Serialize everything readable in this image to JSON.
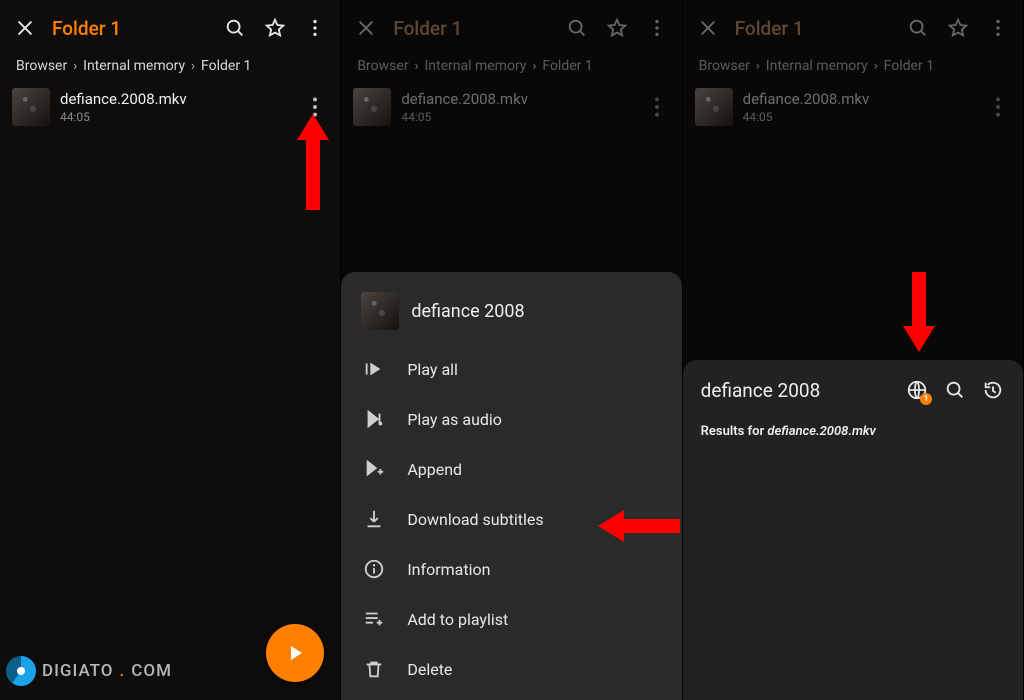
{
  "colors": {
    "accent": "#ff7f00",
    "arrow": "#ff0000"
  },
  "watermark": {
    "text_main": "DIGIATO",
    "text_dot": ".",
    "text_tld": "COM"
  },
  "header": {
    "title": "Folder 1",
    "icons": {
      "close": "close-icon",
      "search": "search-icon",
      "star": "star-icon",
      "more": "more-vert-icon"
    }
  },
  "breadcrumb": [
    "Browser",
    "Internal memory",
    "Folder 1"
  ],
  "file": {
    "name": "defiance.2008.mkv",
    "duration": "44:05"
  },
  "fab": {
    "icon": "play-icon"
  },
  "context_menu": {
    "title": "defiance 2008",
    "items": [
      {
        "icon": "play-all-icon",
        "label": "Play all"
      },
      {
        "icon": "play-audio-icon",
        "label": "Play as audio"
      },
      {
        "icon": "append-icon",
        "label": "Append"
      },
      {
        "icon": "download-icon",
        "label": "Download subtitles"
      },
      {
        "icon": "info-icon",
        "label": "Information"
      },
      {
        "icon": "playlist-add-icon",
        "label": "Add to playlist"
      },
      {
        "icon": "delete-icon",
        "label": "Delete"
      }
    ]
  },
  "subtitle_panel": {
    "title": "defiance 2008",
    "globe_badge": "1",
    "results_prefix": "Results for ",
    "results_file": "defiance.2008.mkv",
    "icons": {
      "globe": "globe-icon",
      "search": "search-icon",
      "history": "history-icon"
    }
  }
}
